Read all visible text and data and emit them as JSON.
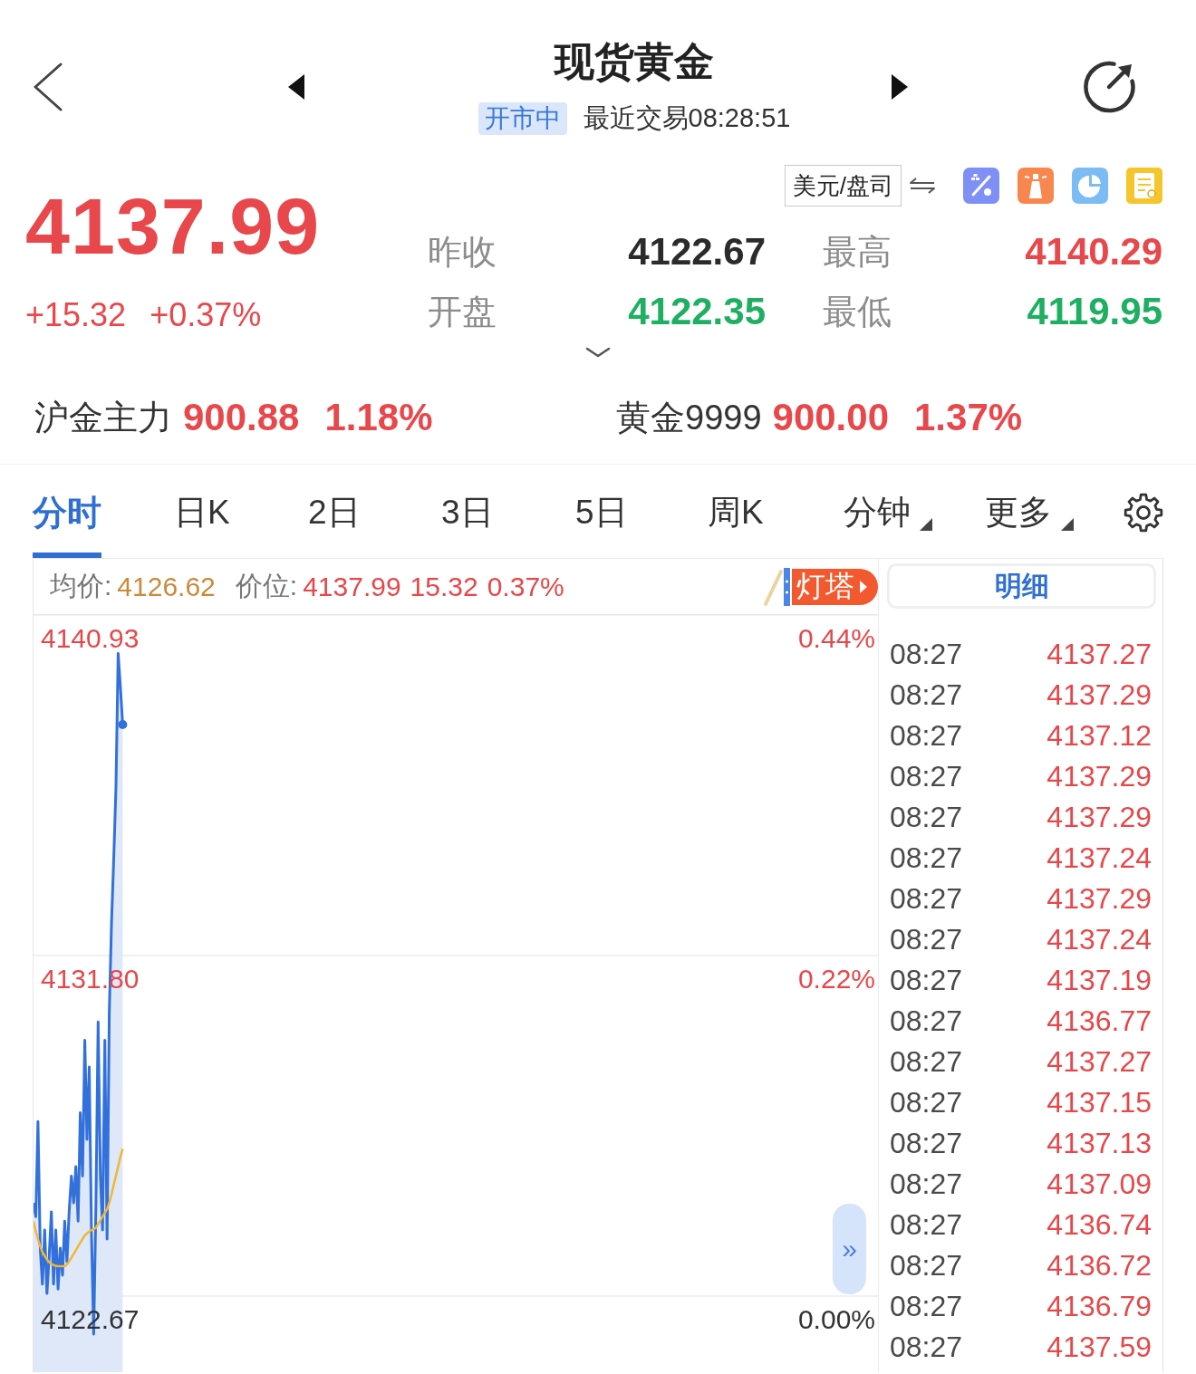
{
  "header": {
    "title": "现货黄金",
    "status": "开市中",
    "last_trade": "最近交易08:28:51"
  },
  "quote": {
    "price": "4137.99",
    "change": "+15.32",
    "change_percent": "+0.37%",
    "unit": "美元/盘司",
    "stats": [
      {
        "label": "昨收",
        "value": "4122.67",
        "color": "#2b2b2b"
      },
      {
        "label": "最高",
        "value": "4140.29",
        "color": "#e8474b"
      },
      {
        "label": "开盘",
        "value": "4122.35",
        "color": "#1faf62"
      },
      {
        "label": "最低",
        "value": "4119.95",
        "color": "#1faf62"
      }
    ]
  },
  "related": [
    {
      "name": "沪金主力",
      "price": "900.88",
      "change_percent": "1.18%"
    },
    {
      "name": "黄金9999",
      "price": "900.00",
      "change_percent": "1.37%"
    }
  ],
  "tabs": [
    {
      "label": "分时",
      "selected": true,
      "dropdown": false
    },
    {
      "label": "日K",
      "selected": false,
      "dropdown": false
    },
    {
      "label": "2日",
      "selected": false,
      "dropdown": false
    },
    {
      "label": "3日",
      "selected": false,
      "dropdown": false
    },
    {
      "label": "5日",
      "selected": false,
      "dropdown": false
    },
    {
      "label": "周K",
      "selected": false,
      "dropdown": false
    },
    {
      "label": "分钟",
      "selected": false,
      "dropdown": true
    },
    {
      "label": "更多",
      "selected": false,
      "dropdown": true
    }
  ],
  "chart": {
    "avg_label": "均价:",
    "avg_value": "4126.62",
    "price_label": "价位:",
    "price_value": "4137.99",
    "change": "15.32",
    "change_percent": "0.37%",
    "tag": "灯塔",
    "percent_labels": [
      "0.44%",
      "0.22%",
      "0.00%"
    ],
    "expand_button": "»",
    "chart_data": {
      "type": "line",
      "categories": [
        null,
        null,
        null,
        null,
        null,
        null,
        null,
        null,
        null,
        null,
        null,
        null,
        null,
        null,
        null,
        null,
        null,
        null,
        null,
        null,
        null,
        null,
        null,
        null,
        null,
        null,
        null,
        null,
        null,
        null,
        null,
        null,
        null,
        null,
        null,
        null,
        null,
        null,
        null,
        null,
        null,
        null,
        null,
        null,
        null,
        null,
        null,
        null,
        null,
        null,
        null,
        null,
        null,
        null,
        null,
        null,
        null,
        null,
        null,
        null,
        null,
        null,
        null,
        null,
        null,
        null,
        null,
        null,
        null,
        null,
        null,
        null,
        null,
        null,
        null,
        null,
        null,
        null,
        null,
        null,
        null,
        null,
        null,
        null,
        null,
        null,
        null,
        null,
        null,
        null,
        null,
        null,
        null,
        null,
        null,
        null,
        null,
        null,
        null,
        null,
        null,
        null,
        null,
        null,
        null,
        null,
        null,
        null,
        null,
        null,
        null,
        null,
        null,
        null,
        null,
        null,
        null,
        null,
        null,
        null,
        null,
        null,
        null,
        null,
        null,
        null,
        null,
        null,
        null,
        null,
        null,
        null,
        null,
        null,
        null,
        null,
        null,
        null,
        null,
        null,
        null,
        null,
        null,
        null,
        null,
        null,
        null,
        null,
        null,
        null,
        null,
        null,
        null,
        null,
        null,
        null,
        null,
        null,
        null,
        null,
        null,
        null,
        null,
        null,
        null,
        null,
        null,
        null,
        null,
        null,
        null,
        null,
        null,
        null,
        null,
        null,
        null,
        null,
        null,
        null,
        null,
        null,
        null,
        null,
        null,
        null,
        null,
        null,
        null,
        null,
        null,
        null,
        null,
        null,
        null,
        null,
        null,
        null,
        null,
        null,
        null,
        null,
        null,
        null,
        null,
        null,
        null,
        null,
        null,
        null,
        null,
        null,
        null,
        null,
        null,
        null,
        null,
        null,
        null,
        null,
        null,
        null,
        null,
        null,
        null,
        null,
        null,
        null,
        null,
        null,
        null,
        null,
        null,
        null,
        null,
        null,
        null,
        null,
        null,
        null,
        null,
        null,
        null,
        null,
        null,
        null,
        null,
        null,
        null,
        null,
        null,
        null,
        null,
        null,
        null,
        null,
        null,
        null,
        null,
        null,
        null,
        null,
        null,
        null,
        null,
        null,
        null,
        null,
        null,
        null,
        null,
        null,
        null,
        null,
        null,
        null,
        null,
        null,
        null,
        null,
        null,
        null,
        null,
        null,
        null,
        null,
        null,
        null,
        null,
        null,
        null,
        null,
        null,
        null,
        null,
        null,
        null,
        null,
        null,
        null,
        null,
        null,
        null,
        null,
        null,
        null,
        null,
        null,
        null,
        null,
        null,
        null,
        null,
        null,
        null,
        null,
        null,
        null,
        null,
        null,
        null,
        null,
        null,
        null,
        null,
        null,
        null,
        null,
        null,
        null,
        null,
        null,
        null,
        null,
        null,
        null,
        null,
        null,
        null,
        null,
        null,
        null,
        null,
        null,
        null,
        null,
        null,
        null,
        null,
        null,
        null,
        null,
        null,
        null,
        null,
        null,
        null,
        null,
        null,
        null,
        null,
        null,
        null,
        null,
        null,
        null,
        null,
        null,
        null,
        null,
        null,
        null,
        null,
        null,
        null,
        null,
        null,
        null,
        null,
        null
      ],
      "ylim": [
        4120.63,
        4140.93
      ],
      "yticks": [
        {
          "value": 4140.93,
          "label": "4140.93"
        },
        {
          "value": 4131.8,
          "label": "4131.80"
        },
        {
          "value": 4122.67,
          "label": "4122.67"
        }
      ],
      "series": [
        {
          "color": "#3270db",
          "values": [
            4125.17,
            4124.8,
            4127.35,
            4123.96,
            4122.99,
            4124.44,
            4122.74,
            4123.71,
            4124.93,
            4122.99,
            4124.44,
            4122.86,
            4123.96,
            4123.23,
            4124.68,
            4123.59,
            4124.93,
            4125.89,
            4125.17,
            4126.14,
            4124.68,
            4127.59,
            4125.89,
            4129.53,
            4126.87,
            4128.81,
            4124.44,
            4121.65,
            4125.17,
            4130.02,
            4125.89,
            4124.44,
            4129.53,
            4124.2,
            4130.26,
            4132.69,
            4134.38,
            4136.32,
            4139.9,
            4138.99,
            4137.99,
            null,
            null,
            null,
            null,
            null,
            null,
            null,
            null,
            null,
            null,
            null,
            null,
            null,
            null,
            null,
            null,
            null,
            null,
            null,
            null,
            null,
            null,
            null,
            null,
            null,
            null,
            null,
            null,
            null,
            null,
            null,
            null,
            null,
            null,
            null,
            null,
            null,
            null,
            null,
            null,
            null,
            null,
            null,
            null,
            null,
            null,
            null,
            null,
            null,
            null,
            null,
            null,
            null,
            null,
            null,
            null,
            null,
            null,
            null,
            null,
            null,
            null,
            null,
            null,
            null,
            null,
            null,
            null,
            null,
            null,
            null,
            null,
            null,
            null,
            null,
            null,
            null,
            null,
            null,
            null,
            null,
            null,
            null,
            null,
            null,
            null,
            null,
            null,
            null,
            null,
            null,
            null,
            null,
            null,
            null,
            null,
            null,
            null,
            null,
            null,
            null,
            null,
            null,
            null,
            null,
            null,
            null,
            null,
            null,
            null,
            null,
            null,
            null,
            null,
            null,
            null,
            null,
            null,
            null,
            null,
            null,
            null,
            null,
            null,
            null,
            null,
            null,
            null,
            null,
            null,
            null,
            null,
            null,
            null,
            null,
            null,
            null,
            null,
            null,
            null,
            null,
            null,
            null,
            null,
            null,
            null,
            null,
            null,
            null,
            null,
            null,
            null,
            null,
            null,
            null,
            null,
            null,
            null,
            null,
            null,
            null,
            null,
            null,
            null,
            null,
            null,
            null,
            null,
            null,
            null,
            null,
            null,
            null,
            null,
            null,
            null,
            null,
            null,
            null,
            null,
            null,
            null,
            null,
            null,
            null,
            null,
            null,
            null,
            null,
            null,
            null,
            null,
            null,
            null,
            null,
            null,
            null,
            null,
            null,
            null,
            null,
            null,
            null,
            null,
            null,
            null,
            null,
            null,
            null,
            null,
            null,
            null,
            null,
            null,
            null,
            null,
            null,
            null,
            null,
            null,
            null,
            null,
            null,
            null,
            null,
            null,
            null,
            null,
            null,
            null,
            null,
            null,
            null,
            null,
            null,
            null,
            null,
            null,
            null,
            null,
            null,
            null,
            null,
            null,
            null,
            null,
            null,
            null,
            null,
            null,
            null,
            null,
            null,
            null,
            null,
            null,
            null,
            null,
            null,
            null,
            null,
            null,
            null,
            null,
            null,
            null,
            null,
            null,
            null,
            null,
            null,
            null,
            null,
            null,
            null,
            null,
            null,
            null,
            null,
            null,
            null,
            null,
            null,
            null,
            null,
            null,
            null,
            null,
            null,
            null,
            null,
            null,
            null,
            null,
            null,
            null,
            null,
            null,
            null,
            null,
            null,
            null,
            null,
            null,
            null,
            null,
            null,
            null,
            null,
            null,
            null,
            null,
            null,
            null,
            null,
            null,
            null,
            null,
            null,
            null,
            null,
            null,
            null,
            null,
            null,
            null,
            null,
            null,
            null,
            null,
            null,
            null,
            null,
            null,
            null,
            null,
            null,
            null,
            null
          ]
        },
        {
          "color": "#f2b632",
          "values": [
            4124.68,
            4124.4,
            4124.2,
            4124.0,
            4123.85,
            4123.75,
            4123.65,
            4123.58,
            4123.54,
            4123.5,
            4123.48,
            4123.47,
            4123.47,
            4123.47,
            4123.47,
            4123.52,
            4123.6,
            4123.7,
            4123.8,
            4123.9,
            4124.0,
            4124.1,
            4124.2,
            4124.3,
            4124.35,
            4124.4,
            4124.44,
            4124.46,
            4124.5,
            4124.6,
            4124.7,
            4124.8,
            4124.9,
            4125.0,
            4125.17,
            4125.4,
            4125.65,
            4125.9,
            4126.15,
            4126.4,
            4126.62,
            null,
            null,
            null,
            null,
            null,
            null,
            null,
            null,
            null,
            null,
            null,
            null,
            null,
            null,
            null,
            null,
            null,
            null,
            null,
            null,
            null,
            null,
            null,
            null,
            null,
            null,
            null,
            null,
            null,
            null,
            null,
            null,
            null,
            null,
            null,
            null,
            null,
            null,
            null,
            null,
            null,
            null,
            null,
            null,
            null,
            null,
            null,
            null,
            null,
            null,
            null,
            null,
            null,
            null,
            null,
            null,
            null,
            null,
            null,
            null,
            null,
            null,
            null,
            null,
            null,
            null,
            null,
            null,
            null,
            null,
            null,
            null,
            null,
            null,
            null,
            null,
            null,
            null,
            null,
            null,
            null,
            null,
            null,
            null,
            null,
            null,
            null,
            null,
            null,
            null,
            null,
            null,
            null,
            null,
            null,
            null,
            null,
            null,
            null,
            null,
            null,
            null,
            null,
            null,
            null,
            null,
            null,
            null,
            null,
            null,
            null,
            null,
            null,
            null,
            null,
            null,
            null,
            null,
            null,
            null,
            null,
            null,
            null,
            null,
            null,
            null,
            null,
            null,
            null,
            null,
            null,
            null,
            null,
            null,
            null,
            null,
            null,
            null,
            null,
            null,
            null,
            null,
            null,
            null,
            null,
            null,
            null,
            null,
            null,
            null,
            null,
            null,
            null,
            null,
            null,
            null,
            null,
            null,
            null,
            null,
            null,
            null,
            null,
            null,
            null,
            null,
            null,
            null,
            null,
            null,
            null,
            null,
            null,
            null,
            null,
            null,
            null,
            null,
            null,
            null,
            null,
            null,
            null,
            null,
            null,
            null,
            null,
            null,
            null,
            null,
            null,
            null,
            null,
            null,
            null,
            null,
            null,
            null,
            null,
            null,
            null,
            null,
            null,
            null,
            null,
            null,
            null,
            null,
            null,
            null,
            null,
            null,
            null,
            null,
            null,
            null,
            null,
            null,
            null,
            null,
            null,
            null,
            null,
            null,
            null,
            null,
            null,
            null,
            null,
            null,
            null,
            null,
            null,
            null,
            null,
            null,
            null,
            null,
            null,
            null,
            null,
            null,
            null,
            null,
            null,
            null,
            null,
            null,
            null,
            null,
            null,
            null,
            null,
            null,
            null,
            null,
            null,
            null,
            null,
            null,
            null,
            null,
            null,
            null,
            null,
            null,
            null,
            null,
            null,
            null,
            null,
            null,
            null,
            null,
            null,
            null,
            null,
            null,
            null,
            null,
            null,
            null,
            null,
            null,
            null,
            null,
            null,
            null,
            null,
            null,
            null,
            null,
            null,
            null,
            null,
            null,
            null,
            null,
            null,
            null,
            null,
            null,
            null,
            null,
            null,
            null,
            null,
            null,
            null,
            null,
            null,
            null,
            null,
            null,
            null,
            null,
            null,
            null,
            null,
            null,
            null,
            null,
            null,
            null,
            null,
            null,
            null,
            null,
            null,
            null,
            null,
            null,
            null,
            null,
            null,
            null,
            null,
            null,
            null
          ]
        }
      ]
    }
  },
  "details": {
    "title": "明细",
    "rows": [
      {
        "time": "08:27",
        "price": "4137.27"
      },
      {
        "time": "08:27",
        "price": "4137.29"
      },
      {
        "time": "08:27",
        "price": "4137.12"
      },
      {
        "time": "08:27",
        "price": "4137.29"
      },
      {
        "time": "08:27",
        "price": "4137.29"
      },
      {
        "time": "08:27",
        "price": "4137.24"
      },
      {
        "time": "08:27",
        "price": "4137.29"
      },
      {
        "time": "08:27",
        "price": "4137.24"
      },
      {
        "time": "08:27",
        "price": "4137.19"
      },
      {
        "time": "08:27",
        "price": "4136.77"
      },
      {
        "time": "08:27",
        "price": "4137.27"
      },
      {
        "time": "08:27",
        "price": "4137.15"
      },
      {
        "time": "08:27",
        "price": "4137.13"
      },
      {
        "time": "08:27",
        "price": "4137.09"
      },
      {
        "time": "08:27",
        "price": "4136.74"
      },
      {
        "time": "08:27",
        "price": "4136.72"
      },
      {
        "time": "08:27",
        "price": "4136.79"
      },
      {
        "time": "08:27",
        "price": "4137.59"
      }
    ]
  }
}
